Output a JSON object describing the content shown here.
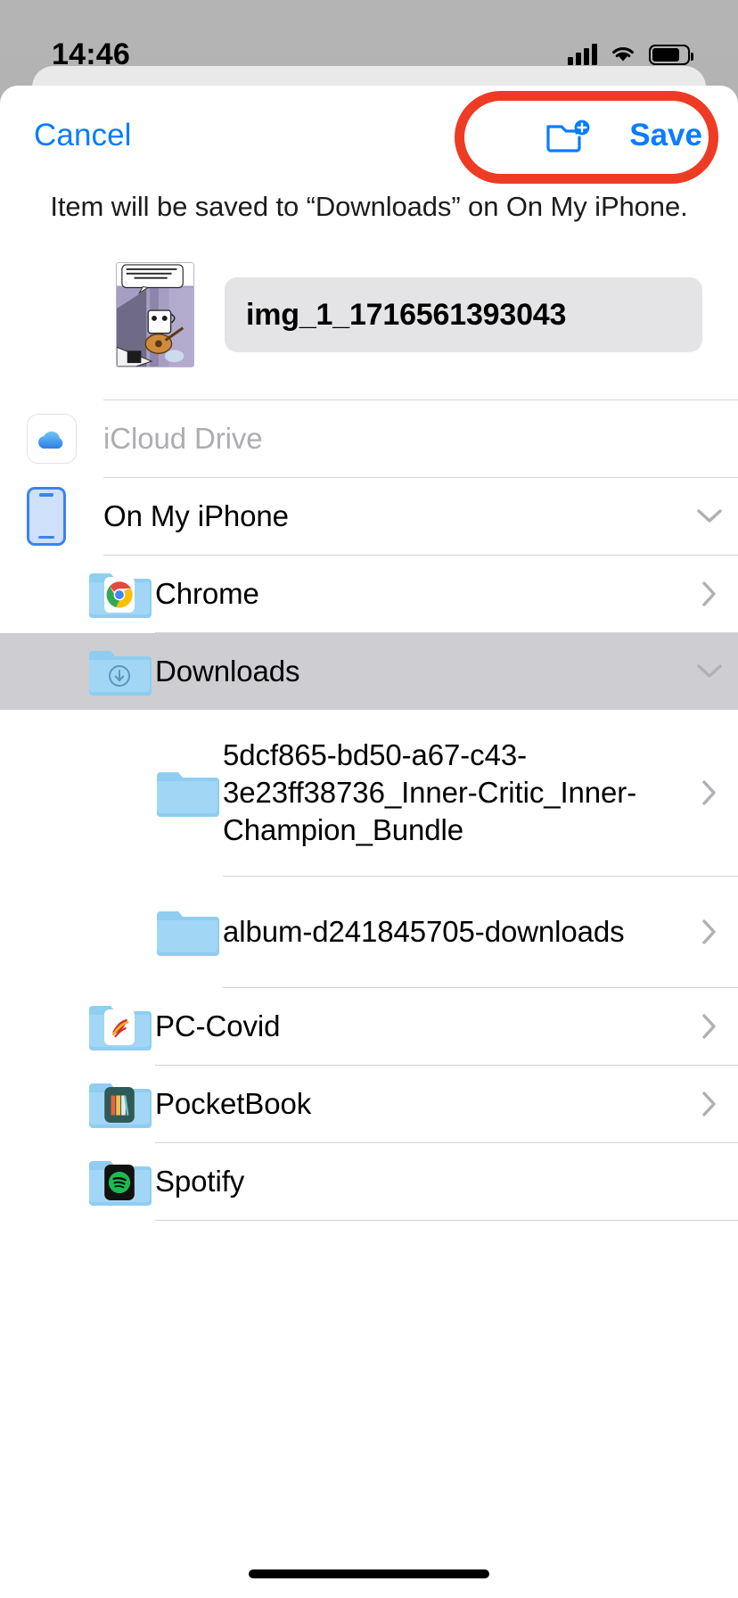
{
  "status_bar": {
    "time": "14:46",
    "signal_icon": "cellular-signal-icon",
    "wifi_icon": "wifi-icon",
    "battery_icon": "battery-icon"
  },
  "navbar": {
    "cancel_label": "Cancel",
    "save_label": "Save",
    "new_folder_icon": "new-folder-icon",
    "highlight_color": "#ee3b24",
    "tint_color": "#0a7cff"
  },
  "subtitle": "Item will be saved to “Downloads” on On My iPhone.",
  "file": {
    "name": "img_1_1716561393043",
    "thumbnail_icon": "comic-thumbnail"
  },
  "locations": [
    {
      "label": "iCloud Drive",
      "icon": "icloud-icon",
      "level": 0,
      "accessory": "none",
      "state": "disabled",
      "selected": false
    },
    {
      "label": "On My iPhone",
      "icon": "iphone-icon",
      "level": 0,
      "accessory": "chevron-down",
      "state": "expanded",
      "selected": false
    },
    {
      "label": "Chrome",
      "icon": "folder-chrome-icon",
      "level": 1,
      "accessory": "chevron-right",
      "state": "collapsed",
      "selected": false
    },
    {
      "label": "Downloads",
      "icon": "folder-downloads-icon",
      "level": 1,
      "accessory": "chevron-down",
      "state": "expanded",
      "selected": true
    },
    {
      "label": "5dcf865-bd50-a67-c43-3e23ff38736_Inner-Critic_Inner-Champion_Bundle",
      "icon": "folder-icon",
      "level": 2,
      "accessory": "chevron-right",
      "state": "collapsed",
      "selected": false
    },
    {
      "label": "album-d241845705-downloads",
      "icon": "folder-icon",
      "level": 2,
      "accessory": "chevron-right",
      "state": "collapsed",
      "selected": false
    },
    {
      "label": "PC-Covid",
      "icon": "folder-pccovid-icon",
      "level": 1,
      "accessory": "chevron-right",
      "state": "collapsed",
      "selected": false
    },
    {
      "label": "PocketBook",
      "icon": "folder-pocketbook-icon",
      "level": 1,
      "accessory": "chevron-right",
      "state": "collapsed",
      "selected": false
    },
    {
      "label": "Spotify",
      "icon": "folder-spotify-icon",
      "level": 1,
      "accessory": "chevron-right",
      "state": "collapsed",
      "selected": false
    }
  ],
  "home_indicator": "home-indicator"
}
